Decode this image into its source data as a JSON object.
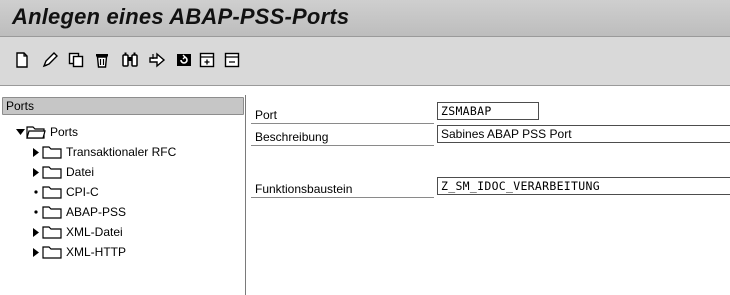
{
  "window": {
    "title": "Anlegen eines ABAP-PSS-Ports"
  },
  "toolbar": {
    "icons": [
      "new-document-icon",
      "edit-icon",
      "copy-icon",
      "delete-icon",
      "find-icon",
      "navigate-icon",
      "refresh-icon",
      "expand-icon",
      "collapse-icon"
    ]
  },
  "tree": {
    "header": "Ports",
    "root": {
      "label": "Ports",
      "marker": "expanded"
    },
    "items": [
      {
        "label": "Transaktionaler RFC",
        "marker": "collapsed"
      },
      {
        "label": "Datei",
        "marker": "collapsed"
      },
      {
        "label": "CPI-C",
        "marker": "leaf"
      },
      {
        "label": "ABAP-PSS",
        "marker": "leaf"
      },
      {
        "label": "XML-Datei",
        "marker": "collapsed"
      },
      {
        "label": "XML-HTTP",
        "marker": "collapsed"
      }
    ]
  },
  "form": {
    "port": {
      "label": "Port",
      "value": "ZSMABAP"
    },
    "description": {
      "label": "Beschreibung",
      "value": "Sabines ABAP PSS Port"
    },
    "function_module": {
      "label": "Funktionsbaustein",
      "value": "Z_SM_IDOC_VERARBEITUNG"
    }
  }
}
